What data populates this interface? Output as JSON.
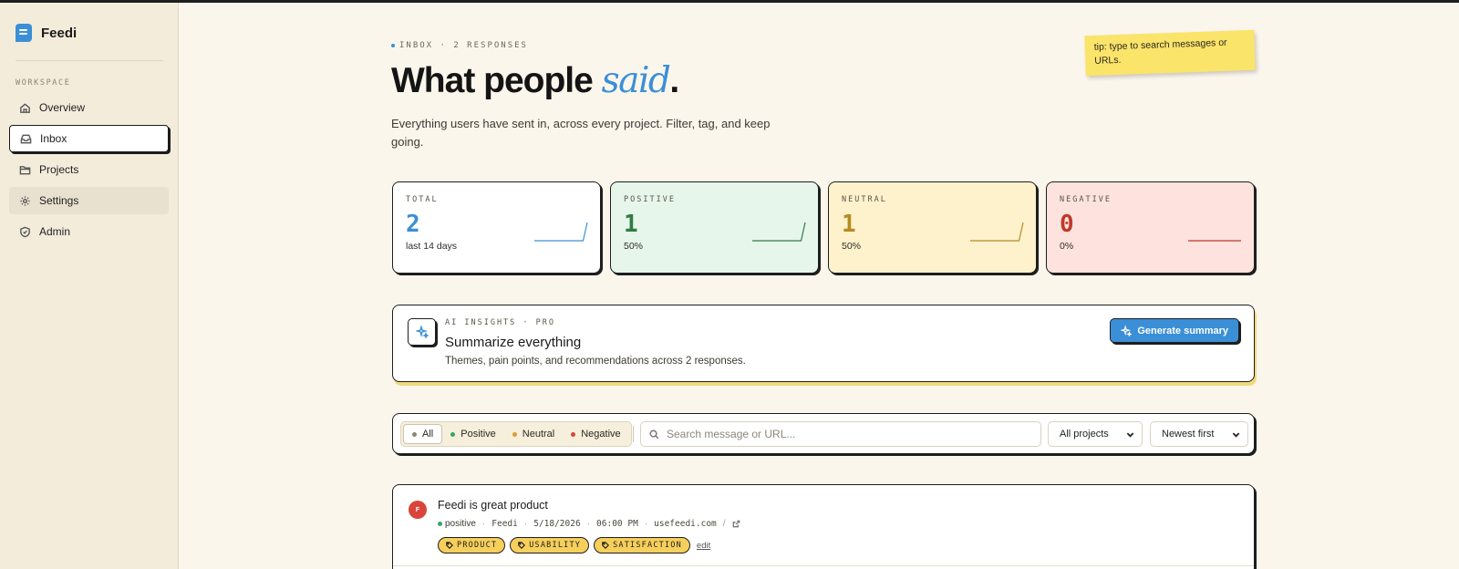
{
  "app": {
    "name": "Feedi"
  },
  "sidebar": {
    "section_label": "WORKSPACE",
    "items": [
      {
        "label": "Overview",
        "icon": "home-icon"
      },
      {
        "label": "Inbox",
        "icon": "inbox-icon",
        "active": true
      },
      {
        "label": "Projects",
        "icon": "folder-icon"
      },
      {
        "label": "Settings",
        "icon": "gear-icon"
      },
      {
        "label": "Admin",
        "icon": "shield-icon"
      }
    ]
  },
  "header": {
    "eyebrow": "INBOX · 2 RESPONSES",
    "title_main": "What people ",
    "title_accent": "said",
    "title_end": ".",
    "subtitle": "Everything users have sent in, across every project. Filter, tag, and keep going.",
    "tip": "tip: type to search messages or URLs."
  },
  "stats": [
    {
      "label": "TOTAL",
      "value": "2",
      "sub": "last 14 days",
      "color": "#3b8fd6",
      "bg": "#ffffff",
      "spark": [
        0,
        0,
        0,
        0,
        0,
        0,
        0,
        0,
        0,
        0,
        0,
        0,
        0,
        2
      ]
    },
    {
      "label": "POSITIVE",
      "value": "1",
      "sub": "50%",
      "color": "#2e7d43",
      "bg": "#e7f6ea",
      "spark": [
        0,
        0,
        0,
        0,
        0,
        0,
        0,
        0,
        0,
        0,
        0,
        0,
        0,
        1
      ]
    },
    {
      "label": "NEUTRAL",
      "value": "1",
      "sub": "50%",
      "color": "#b58a24",
      "bg": "#fdf2cc",
      "spark": [
        0,
        0,
        0,
        0,
        0,
        0,
        0,
        0,
        0,
        0,
        0,
        0,
        0,
        1
      ]
    },
    {
      "label": "NEGATIVE",
      "value": "0",
      "sub": "0%",
      "color": "#c0392b",
      "bg": "#fde2dd",
      "spark": [
        0,
        0,
        0,
        0,
        0,
        0,
        0,
        0,
        0,
        0,
        0,
        0,
        0,
        0
      ]
    }
  ],
  "ai": {
    "eyebrow": "AI INSIGHTS · PRO",
    "title": "Summarize everything",
    "desc": "Themes, pain points, and recommendations across 2 responses.",
    "button": "Generate summary"
  },
  "filters": {
    "segments": [
      {
        "label": "All",
        "dot": "#8a8578",
        "active": true
      },
      {
        "label": "Positive",
        "dot": "#3aa564"
      },
      {
        "label": "Neutral",
        "dot": "#e29a2f"
      },
      {
        "label": "Negative",
        "dot": "#d9453a"
      }
    ],
    "search_placeholder": "Search message or URL...",
    "project_select": "All projects",
    "sort_select": "Newest first"
  },
  "feedback": [
    {
      "avatar": "F",
      "title": "Feedi is great product",
      "sentiment": "positive",
      "project": "Feedi",
      "date": "5/18/2026",
      "time": "06:00 PM",
      "url": "usefeedi.com",
      "url_suffix": "/",
      "tags": [
        "PRODUCT",
        "USABILITY",
        "SATISFACTION"
      ],
      "edit_label": "edit"
    }
  ]
}
